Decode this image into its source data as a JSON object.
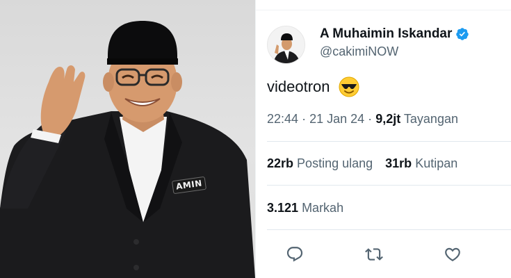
{
  "photo": {
    "badge_text": "AMIN"
  },
  "tweet": {
    "display_name": "A Muhaimin Iskandar",
    "handle": "@cakimiNOW",
    "text": "videotron",
    "emoji_icon": "smiling-face-with-sunglasses-icon",
    "time": "22:44",
    "separator": "·",
    "date": "21 Jan 24",
    "views_count": "9,2jt",
    "views_label": "Tayangan",
    "reposts_count": "22rb",
    "reposts_label": "Posting ulang",
    "quotes_count": "31rb",
    "quotes_label": "Kutipan",
    "bookmarks_count": "3.121",
    "bookmarks_label": "Markah"
  },
  "colors": {
    "text_primary": "#0f1419",
    "text_secondary": "#536471",
    "verified_blue": "#1d9bf0",
    "divider": "#e1e8ed"
  },
  "actions": [
    {
      "icon": "reply-icon"
    },
    {
      "icon": "repost-icon"
    },
    {
      "icon": "like-icon"
    }
  ]
}
